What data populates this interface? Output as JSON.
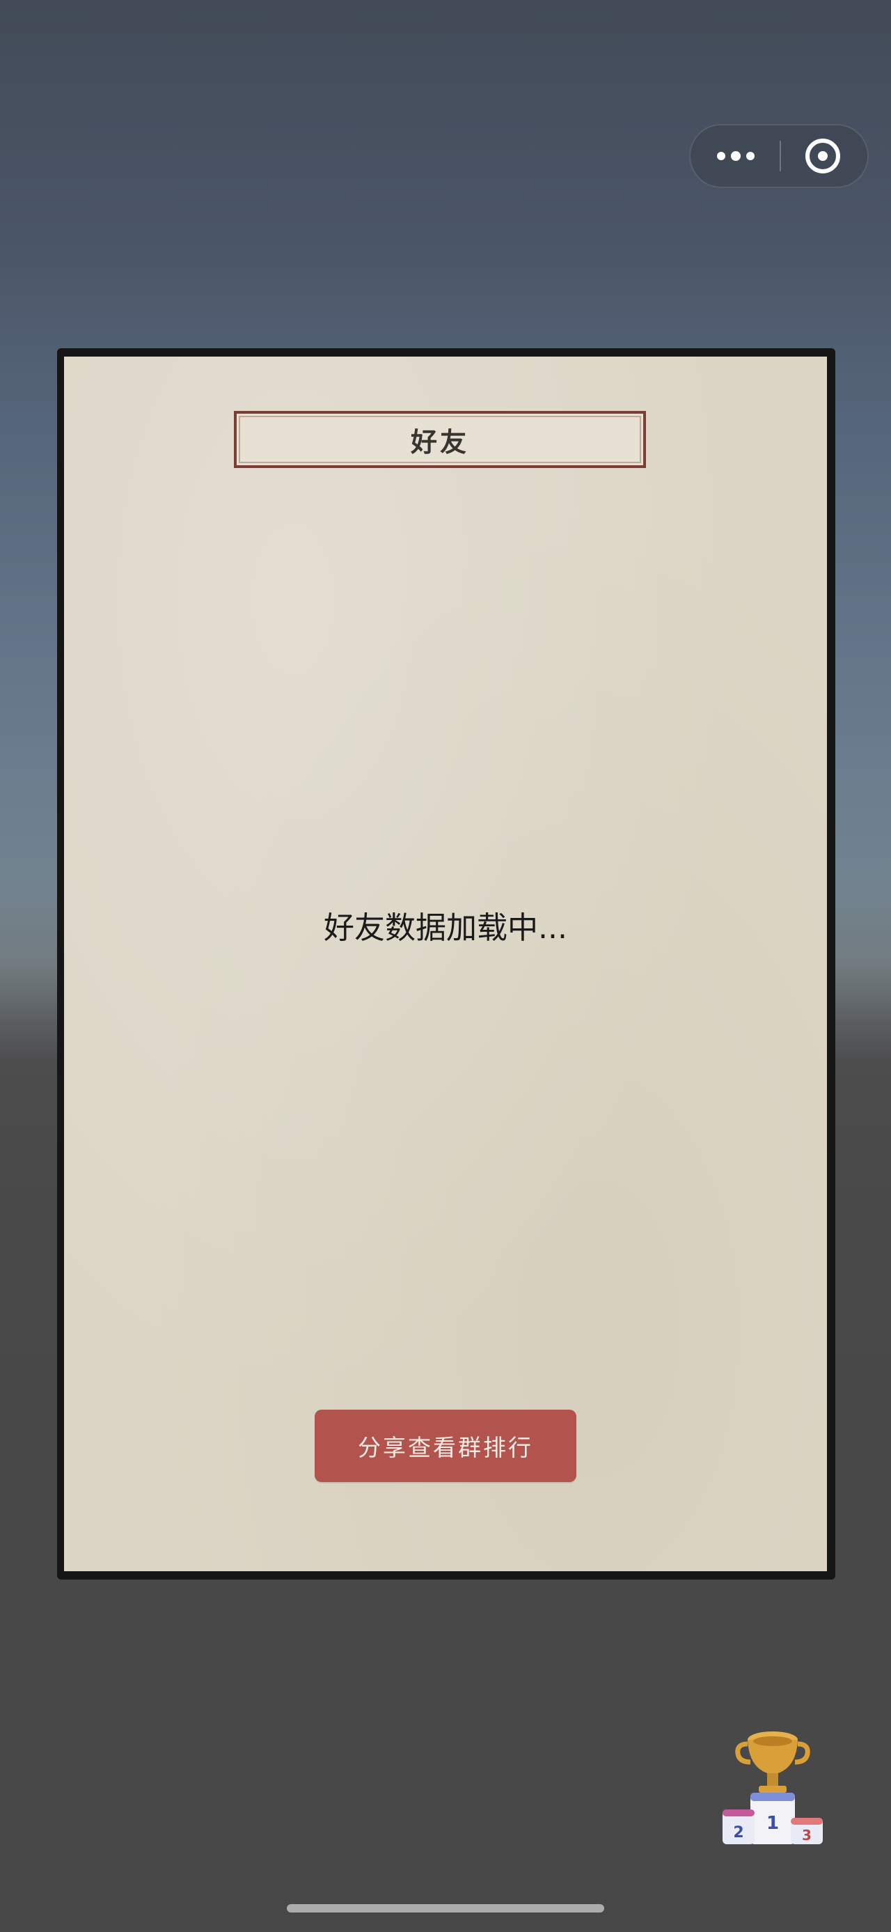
{
  "capsule": {
    "more_icon": "more-dots-icon",
    "close_icon": "target-circle-icon"
  },
  "panel": {
    "title": "好友",
    "loading_text": "好友数据加载中...",
    "share_button_label": "分享查看群排行"
  },
  "trophy": {
    "icon": "trophy-podium-icon",
    "podium_numbers": [
      "2",
      "1",
      "3"
    ]
  },
  "colors": {
    "paper": "#dcd6c6",
    "frame": "#161616",
    "title_border": "#7a3e36",
    "button": "#b2534e",
    "trophy_gold": "#d9a03a",
    "podium_blue": "#7d8fd6"
  }
}
